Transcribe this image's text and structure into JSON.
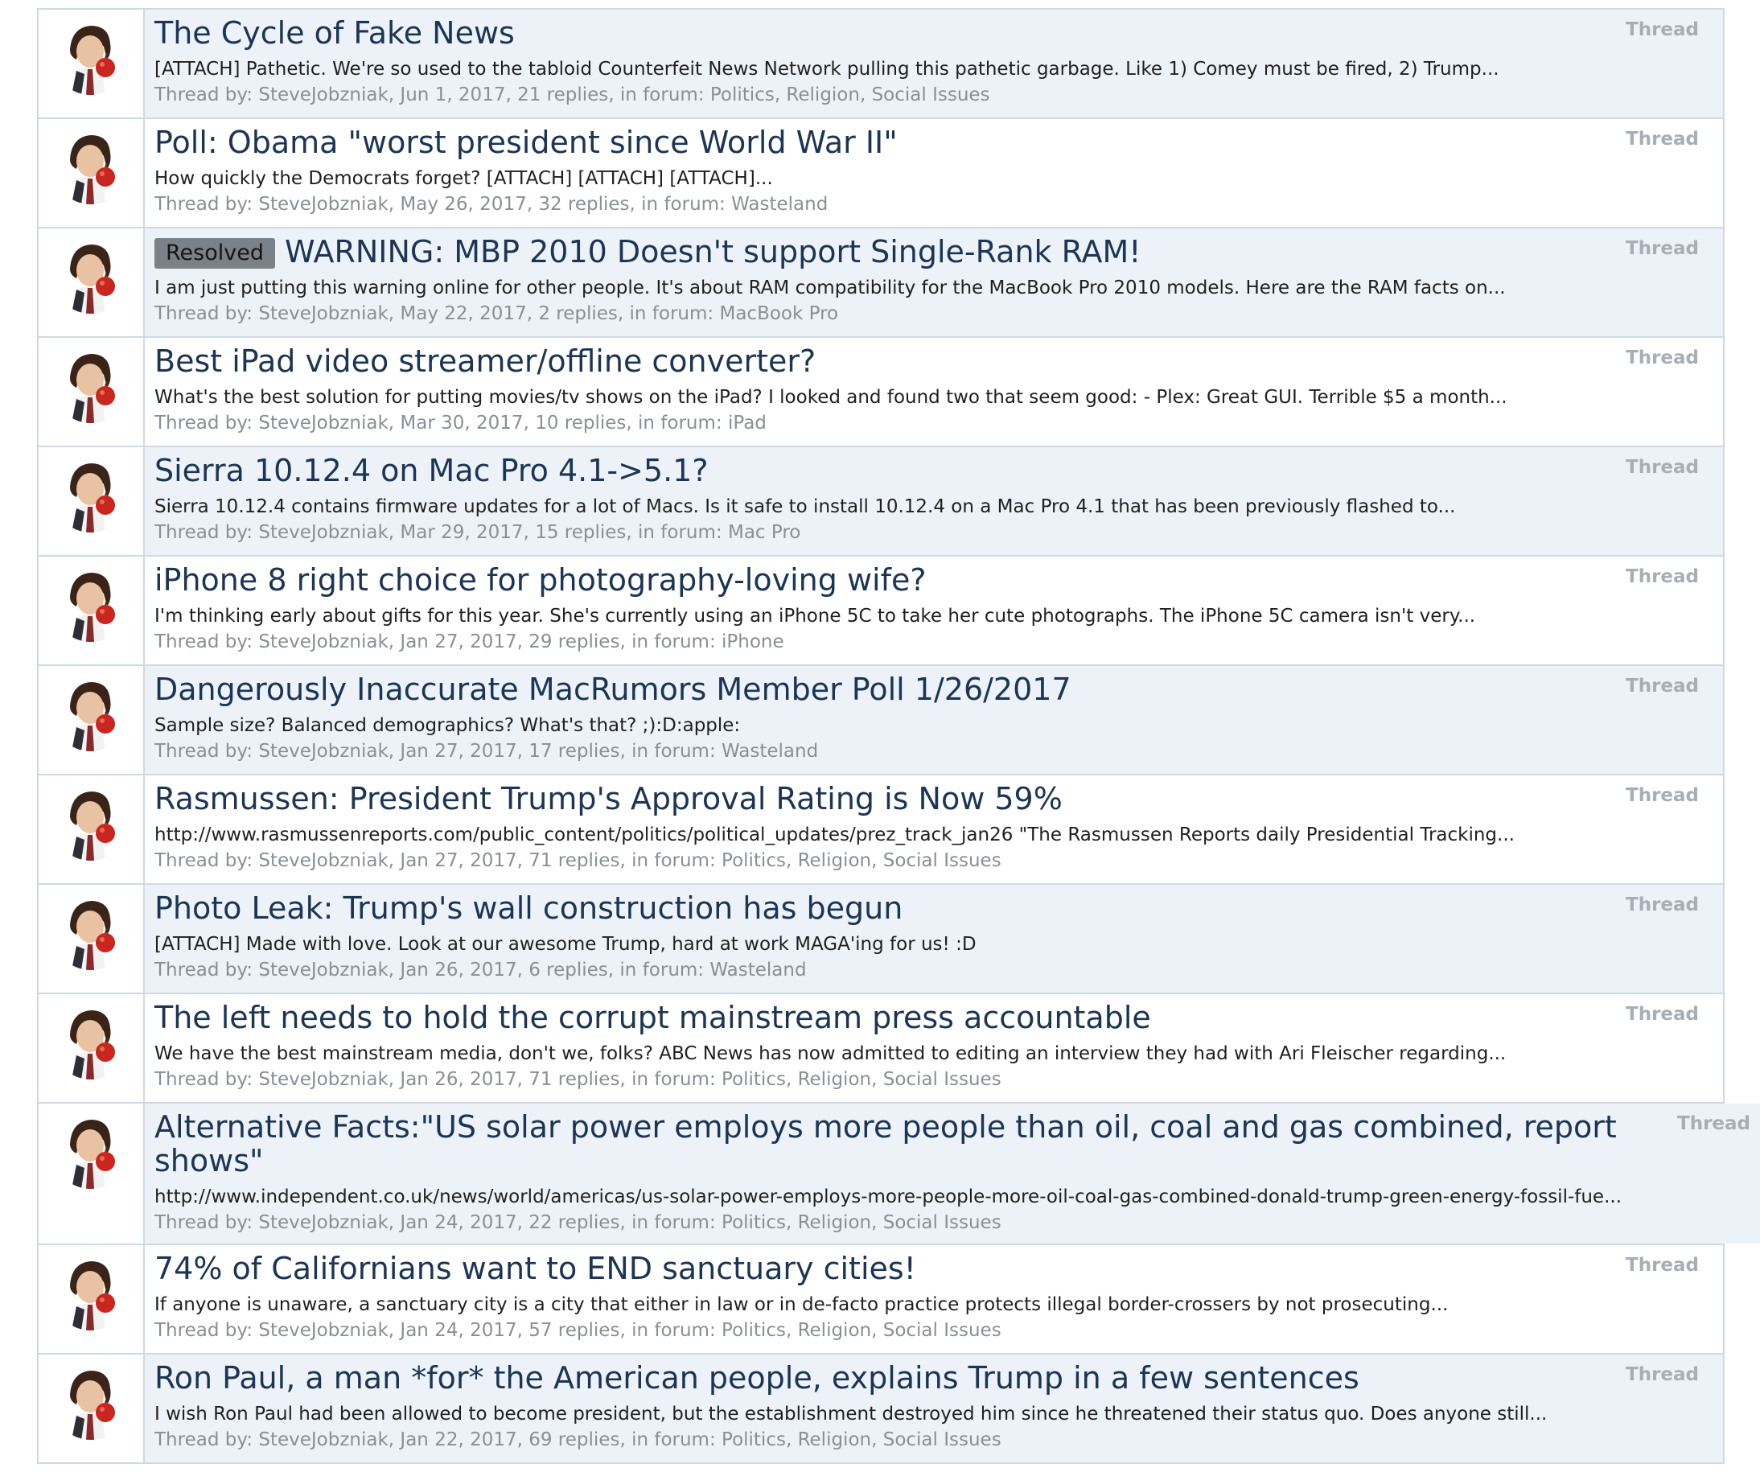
{
  "results": [
    {
      "badge": "",
      "title": "The Cycle of Fake News",
      "snippet": "[ATTACH] Pathetic. We're so used to the tabloid Counterfeit News Network pulling this pathetic garbage. Like 1) Comey must be fired, 2) Trump...",
      "meta_prefix": "Thread by:",
      "author": "SteveJobzniak",
      "date": "Jun 1, 2017",
      "replies": "21 replies",
      "forum_prefix": "in forum:",
      "forum": "Politics, Religion, Social Issues",
      "type": "Thread"
    },
    {
      "badge": "",
      "title": "Poll: Obama \"worst president since World War II\"",
      "snippet": "How quickly the Democrats forget? [ATTACH] [ATTACH] [ATTACH]...",
      "meta_prefix": "Thread by:",
      "author": "SteveJobzniak",
      "date": "May 26, 2017",
      "replies": "32 replies",
      "forum_prefix": "in forum:",
      "forum": "Wasteland",
      "type": "Thread"
    },
    {
      "badge": "Resolved",
      "title": "WARNING: MBP 2010 Doesn't support Single-Rank RAM!",
      "snippet": "I am just putting this warning online for other people. It's about RAM compatibility for the MacBook Pro 2010 models. Here are the RAM facts on...",
      "meta_prefix": "Thread by:",
      "author": "SteveJobzniak",
      "date": "May 22, 2017",
      "replies": "2 replies",
      "forum_prefix": "in forum:",
      "forum": "MacBook Pro",
      "type": "Thread"
    },
    {
      "badge": "",
      "title": "Best iPad video streamer/offline converter?",
      "snippet": "What's the best solution for putting movies/tv shows on the iPad? I looked and found two that seem good: - Plex: Great GUI. Terrible $5 a month...",
      "meta_prefix": "Thread by:",
      "author": "SteveJobzniak",
      "date": "Mar 30, 2017",
      "replies": "10 replies",
      "forum_prefix": "in forum:",
      "forum": "iPad",
      "type": "Thread"
    },
    {
      "badge": "",
      "title": "Sierra 10.12.4 on Mac Pro 4.1->5.1?",
      "snippet": "Sierra 10.12.4 contains firmware updates for a lot of Macs. Is it safe to install 10.12.4 on a Mac Pro 4.1 that has been previously flashed to...",
      "meta_prefix": "Thread by:",
      "author": "SteveJobzniak",
      "date": "Mar 29, 2017",
      "replies": "15 replies",
      "forum_prefix": "in forum:",
      "forum": "Mac Pro",
      "type": "Thread"
    },
    {
      "badge": "",
      "title": "iPhone 8 right choice for photography-loving wife?",
      "snippet": "I'm thinking early about gifts for this year. She's currently using an iPhone 5C to take her cute photographs. The iPhone 5C camera isn't very...",
      "meta_prefix": "Thread by:",
      "author": "SteveJobzniak",
      "date": "Jan 27, 2017",
      "replies": "29 replies",
      "forum_prefix": "in forum:",
      "forum": "iPhone",
      "type": "Thread"
    },
    {
      "badge": "",
      "title": "Dangerously Inaccurate MacRumors Member Poll 1/26/2017",
      "snippet": "Sample size? Balanced demographics? What's that? ;):D:apple:",
      "meta_prefix": "Thread by:",
      "author": "SteveJobzniak",
      "date": "Jan 27, 2017",
      "replies": "17 replies",
      "forum_prefix": "in forum:",
      "forum": "Wasteland",
      "type": "Thread"
    },
    {
      "badge": "",
      "title": "Rasmussen: President Trump's Approval Rating is Now 59%",
      "snippet": "http://www.rasmussenreports.com/public_content/politics/political_updates/prez_track_jan26 \"The Rasmussen Reports daily Presidential Tracking...",
      "meta_prefix": "Thread by:",
      "author": "SteveJobzniak",
      "date": "Jan 27, 2017",
      "replies": "71 replies",
      "forum_prefix": "in forum:",
      "forum": "Politics, Religion, Social Issues",
      "type": "Thread"
    },
    {
      "badge": "",
      "title": "Photo Leak: Trump's wall construction has begun",
      "snippet": "[ATTACH] Made with love. Look at our awesome Trump, hard at work MAGA'ing for us! :D",
      "meta_prefix": "Thread by:",
      "author": "SteveJobzniak",
      "date": "Jan 26, 2017",
      "replies": "6 replies",
      "forum_prefix": "in forum:",
      "forum": "Wasteland",
      "type": "Thread"
    },
    {
      "badge": "",
      "title": "The left needs to hold the corrupt mainstream press accountable",
      "snippet": "We have the best mainstream media, don't we, folks? ABC News has now admitted to editing an interview they had with Ari Fleischer regarding...",
      "meta_prefix": "Thread by:",
      "author": "SteveJobzniak",
      "date": "Jan 26, 2017",
      "replies": "71 replies",
      "forum_prefix": "in forum:",
      "forum": "Politics, Religion, Social Issues",
      "type": "Thread"
    },
    {
      "badge": "",
      "title": "Alternative Facts:\"US solar power employs more people than oil, coal and gas combined, report shows\"",
      "snippet": "http://www.independent.co.uk/news/world/americas/us-solar-power-employs-more-people-more-oil-coal-gas-combined-donald-trump-green-energy-fossil-fue...",
      "meta_prefix": "Thread by:",
      "author": "SteveJobzniak",
      "date": "Jan 24, 2017",
      "replies": "22 replies",
      "forum_prefix": "in forum:",
      "forum": "Politics, Religion, Social Issues",
      "type": "Thread"
    },
    {
      "badge": "",
      "title": "74% of Californians want to END sanctuary cities!",
      "snippet": "If anyone is unaware, a sanctuary city is a city that either in law or in de-facto practice protects illegal border-crossers by not prosecuting...",
      "meta_prefix": "Thread by:",
      "author": "SteveJobzniak",
      "date": "Jan 24, 2017",
      "replies": "57 replies",
      "forum_prefix": "in forum:",
      "forum": "Politics, Religion, Social Issues",
      "type": "Thread"
    },
    {
      "badge": "",
      "title": "Ron Paul, a man *for* the American people, explains Trump in a few sentences",
      "snippet": "I wish Ron Paul had been allowed to become president, but the establishment destroyed him since he threatened their status quo. Does anyone still...",
      "meta_prefix": "Thread by:",
      "author": "SteveJobzniak",
      "date": "Jan 22, 2017",
      "replies": "69 replies",
      "forum_prefix": "in forum:",
      "forum": "Politics, Religion, Social Issues",
      "type": "Thread"
    }
  ]
}
